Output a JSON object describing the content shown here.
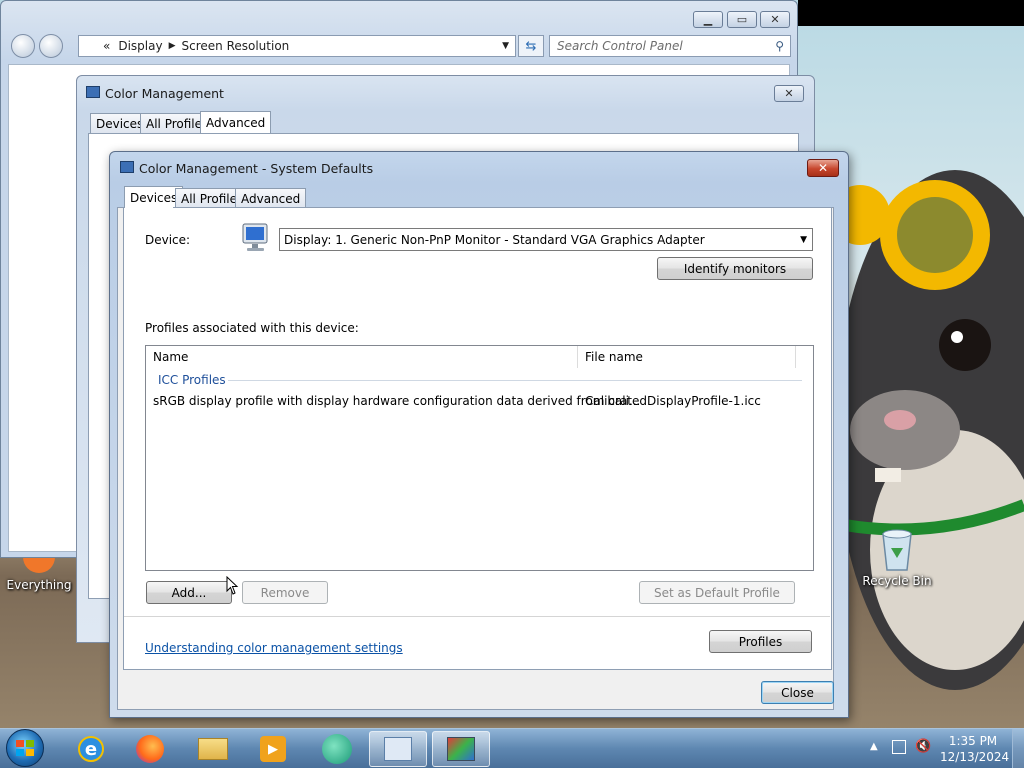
{
  "explorer": {
    "breadcrumb_prefix": "«",
    "breadcrumb": [
      "Display",
      "Screen Resolution"
    ],
    "search_placeholder": "Search Control Panel"
  },
  "color_management": {
    "title": "Color Management",
    "tabs": [
      "Devices",
      "All Profiles",
      "Advanced"
    ],
    "selected_tab": "Advanced"
  },
  "system_defaults": {
    "title": "Color Management - System Defaults",
    "tabs": [
      "Devices",
      "All Profiles",
      "Advanced"
    ],
    "selected_tab": "Devices",
    "device_label": "Device:",
    "device_value": "Display: 1. Generic Non-PnP Monitor - Standard VGA Graphics Adapter",
    "identify_button": "Identify monitors",
    "profiles_label": "Profiles associated with this device:",
    "columns": [
      "Name",
      "File name"
    ],
    "group_label": "ICC Profiles",
    "rows": [
      {
        "name": "sRGB display profile with display hardware configuration data derived from cali...",
        "file": "CalibratedDisplayProfile-1.icc"
      }
    ],
    "add_button": "Add...",
    "remove_button": "Remove",
    "default_button": "Set as Default Profile",
    "profiles_button": "Profiles",
    "help_link": "Understanding color management settings",
    "close_button": "Close"
  },
  "desktop_icons": [
    {
      "label": "Everything"
    },
    {
      "label": "Recycle Bin"
    }
  ],
  "taskbar": {
    "time": "1:35 PM",
    "date": "12/13/2024"
  }
}
